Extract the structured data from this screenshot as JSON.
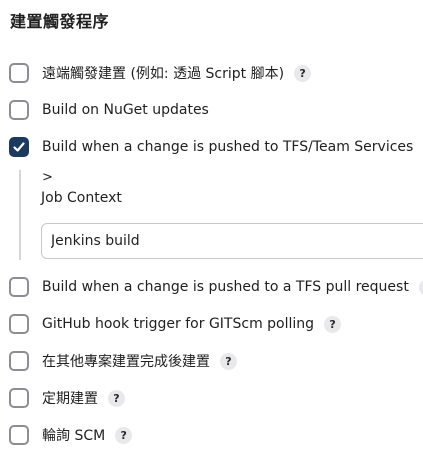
{
  "section": {
    "title": "建置觸發程序"
  },
  "triggers": [
    {
      "label": "遠端觸發建置 (例如: 透過 Script 腳本)",
      "checked": false,
      "has_help": true
    },
    {
      "label": "Build on NuGet updates",
      "checked": false,
      "has_help": false
    },
    {
      "label": "Build when a change is pushed to TFS/Team Services",
      "checked": true,
      "has_help": true
    },
    {
      "label": "Build when a change is pushed to a TFS pull request",
      "checked": false,
      "has_help": true
    },
    {
      "label": "GitHub hook trigger for GITScm polling",
      "checked": false,
      "has_help": true
    },
    {
      "label": "在其他專案建置完成後建置",
      "checked": false,
      "has_help": true
    },
    {
      "label": "定期建置",
      "checked": false,
      "has_help": true
    },
    {
      "label": "輪詢 SCM",
      "checked": false,
      "has_help": true
    }
  ],
  "help_glyph": "?",
  "nested": {
    "expander": ">",
    "job_context_label": "Job Context",
    "job_context_value": "Jenkins build"
  }
}
